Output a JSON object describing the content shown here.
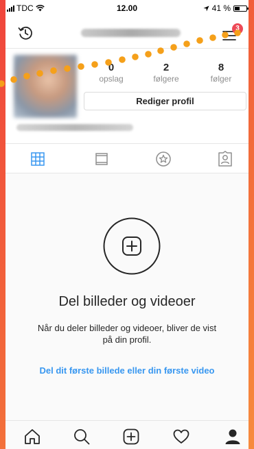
{
  "status_bar": {
    "carrier": "TDC",
    "time": "12.00",
    "battery_percent": "41 %",
    "battery_level": 0.41
  },
  "top_nav": {
    "notification_count": "3"
  },
  "profile": {
    "stats": [
      {
        "value": "0",
        "label": "opslag"
      },
      {
        "value": "2",
        "label": "følgere"
      },
      {
        "value": "8",
        "label": "følger"
      }
    ],
    "edit_button_label": "Rediger profil"
  },
  "tabs": [
    {
      "icon": "grid-icon",
      "active": true
    },
    {
      "icon": "feed-list-icon",
      "active": false
    },
    {
      "icon": "star-icon",
      "active": false
    },
    {
      "icon": "tagged-person-icon",
      "active": false
    }
  ],
  "empty_state": {
    "title": "Del billeder og videoer",
    "description": "Når du deler billeder og videoer, bliver de vist på din profil.",
    "link_label": "Del dit første billede eller din første video"
  },
  "bottom_nav": [
    {
      "icon": "home-icon"
    },
    {
      "icon": "search-icon"
    },
    {
      "icon": "add-post-icon"
    },
    {
      "icon": "heart-icon"
    },
    {
      "icon": "profile-icon",
      "active": true
    }
  ],
  "colors": {
    "accent": "#3897f0",
    "badge": "#ed4956",
    "annotation": "#f5a01a",
    "background_gradient_start": "#f0453c",
    "background_gradient_end": "#f78b3d"
  }
}
